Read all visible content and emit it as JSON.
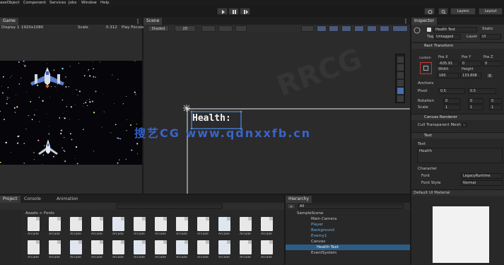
{
  "menu": {
    "items": [
      "aseObject",
      "Component",
      "Services",
      "Jobs",
      "Window",
      "Help"
    ]
  },
  "toolbar": {
    "play": "play-icon",
    "pause": "pause-icon",
    "step": "step-icon",
    "layers_label": "Layers",
    "layout_label": "Layout"
  },
  "game": {
    "tab_label": "Game",
    "display_label": "Display 1",
    "resolution_label": "1920x1080",
    "scale_label": "Scale",
    "scale_value": "0.312",
    "play_focused_label": "Play Focused"
  },
  "scene": {
    "tab_label": "Scene",
    "shaded_label": "Shaded",
    "mode_label": "2D",
    "health_text": "Health:"
  },
  "inspector": {
    "tab_label": "Inspector",
    "object_name": "Health Text",
    "static_label": "Static",
    "tag_label": "Tag",
    "tag_value": "Untagged",
    "layer_label": "Layer",
    "layer_value": "UI",
    "rect_transform_label": "Rect Transform",
    "custom_label": "custom",
    "pos_x_label": "Pos X",
    "pos_y_label": "Pos Y",
    "pos_z_label": "Pos Z",
    "pos_x": "-635.91",
    "pos_y": "0",
    "pos_z": "0",
    "width_label": "Width",
    "height_label": "Height",
    "width": "160",
    "height": "133.808",
    "anchors_label": "Anchors",
    "pivot_label": "Pivot",
    "pivot_x": "0.5",
    "pivot_y": "0.5",
    "rotation_label": "Rotation",
    "rot_x": "0",
    "rot_y": "0",
    "rot_z": "0",
    "scale_label": "Scale",
    "scale_x": "1",
    "scale_y": "1",
    "scale_z": "1",
    "canvas_renderer_label": "Canvas Renderer",
    "cull_label": "Cull Transparent Mesh",
    "text_component_label": "Text",
    "text_label": "Text",
    "text_value": "Health",
    "character_label": "Character",
    "font_label": "Font",
    "font_value": "LegacyRuntime",
    "font_style_label": "Font Style",
    "font_style_value": "Normal",
    "material_label": "Default UI Material"
  },
  "project": {
    "tab_project": "Project",
    "tab_console": "Console",
    "tab_animation": "Animation",
    "breadcrumb": "Assets > Fonts",
    "asset_labels": [
      "Arcade",
      "Arcade",
      "Arcade",
      "Arcade",
      "Arcade",
      "Arcade",
      "Arcade",
      "Arcade",
      "Arcade",
      "Arcade",
      "Arcade",
      "Arcade",
      "Arcade",
      "Arcade",
      "Arcade",
      "Arcade",
      "Arcade",
      "Arcade",
      "Arcade",
      "Arcade",
      "Arcade",
      "Arcade",
      "Arcade",
      "Arcade"
    ]
  },
  "hierarchy": {
    "tab_label": "Hierarchy",
    "search_placeholder": "All",
    "scene_name": "SampleScene",
    "items": [
      "Main Camera",
      "Player",
      "Background",
      "Enemy1",
      "Canvas",
      "Health Text",
      "EventSystem"
    ]
  },
  "watermark": {
    "text": "搜艺CG www.qdnxxfb.cn",
    "logo_text": "RRCG"
  }
}
